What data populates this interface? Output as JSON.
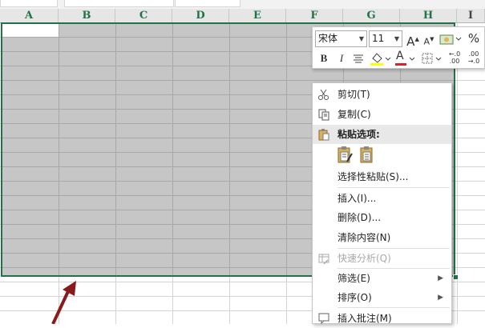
{
  "columns": [
    "A",
    "B",
    "C",
    "D",
    "E",
    "F",
    "G",
    "H",
    "I"
  ],
  "mini_toolbar": {
    "font_name": "宋体",
    "font_size": "11",
    "increase_font": "A",
    "decrease_font": "A",
    "percent": "%",
    "bold": "B",
    "italic": "I",
    "font_color_letter": "A",
    "increase_decimal": "←.0\n.00",
    "decrease_decimal": ".00\n→.0"
  },
  "context_menu": {
    "cut": "剪切(T)",
    "copy": "复制(C)",
    "paste_options": "粘贴选项:",
    "paste_special": "选择性粘贴(S)...",
    "insert": "插入(I)...",
    "delete": "删除(D)...",
    "clear_contents": "清除内容(N)",
    "quick_analysis": "快速分析(Q)",
    "filter": "筛选(E)",
    "sort": "排序(O)",
    "insert_comment": "插入批注(M)"
  },
  "colors": {
    "accent": "#217346",
    "selection": "#c6c6c6",
    "arrow": "#8b1a1a"
  }
}
